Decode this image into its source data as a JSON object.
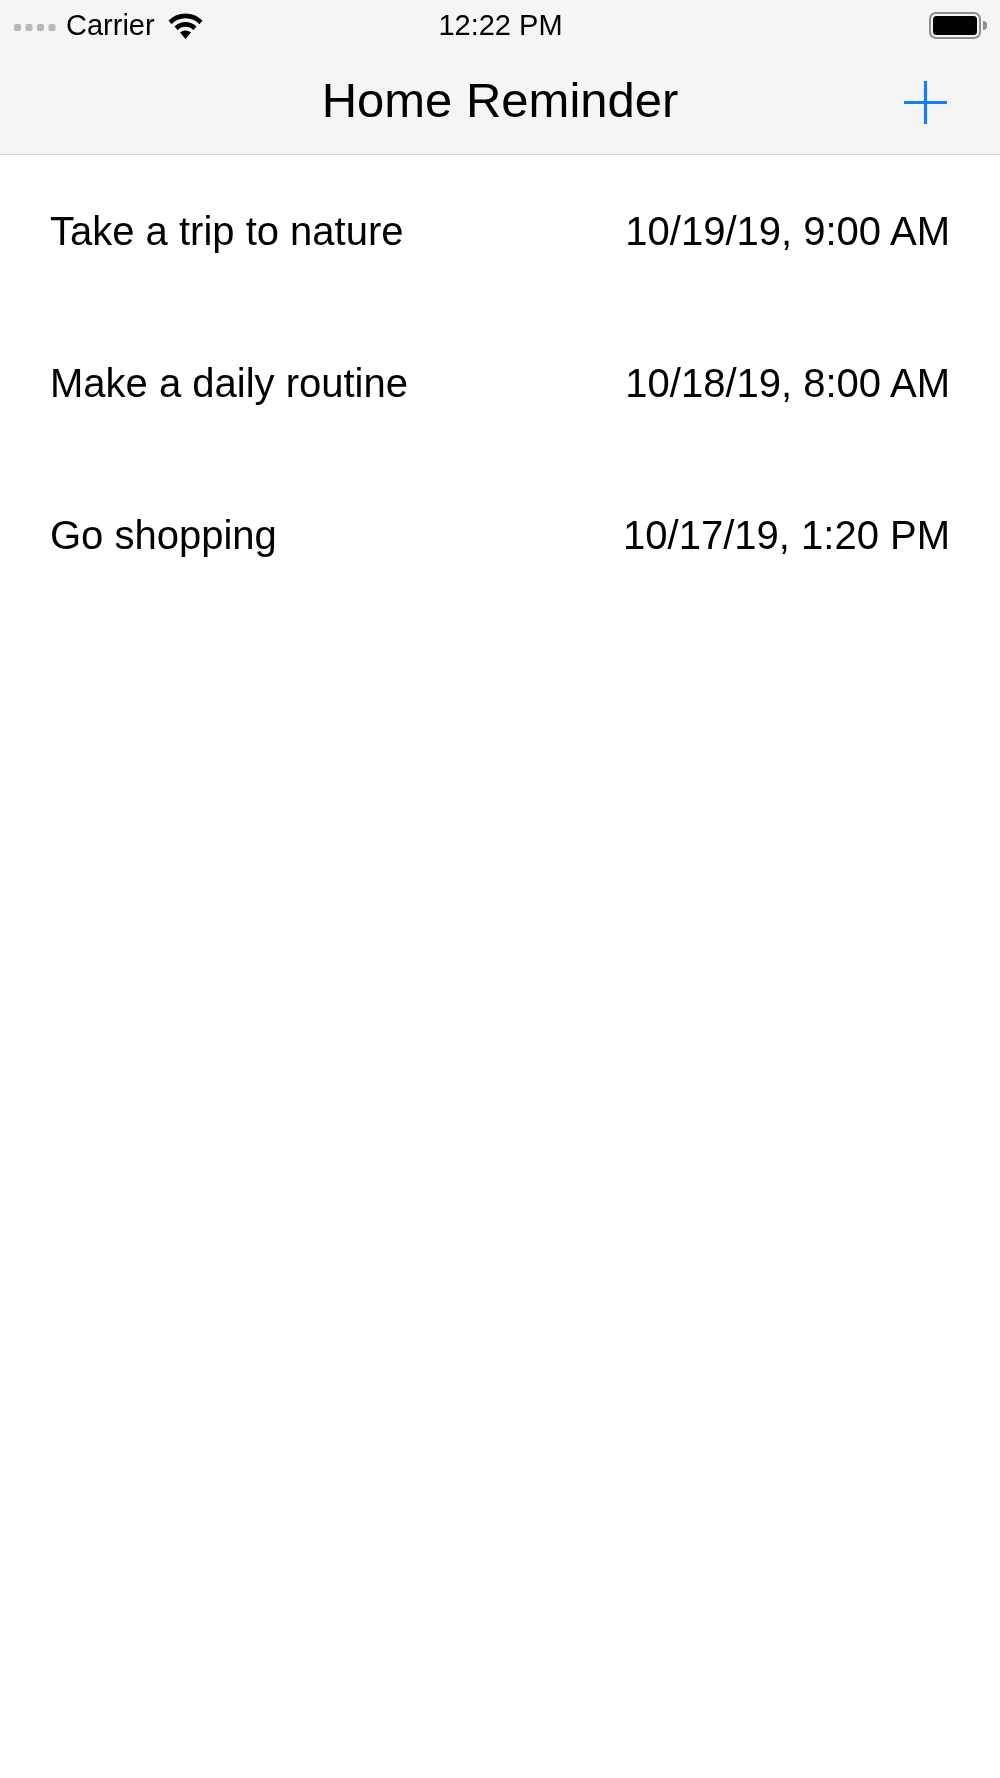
{
  "status_bar": {
    "carrier": "Carrier",
    "time": "12:22 PM"
  },
  "nav_bar": {
    "title": "Home Reminder"
  },
  "reminders": [
    {
      "title": "Take a trip to nature",
      "date": "10/19/19, 9:00 AM"
    },
    {
      "title": "Make a daily routine",
      "date": "10/18/19, 8:00 AM"
    },
    {
      "title": "Go shopping",
      "date": "10/17/19, 1:20 PM"
    }
  ]
}
